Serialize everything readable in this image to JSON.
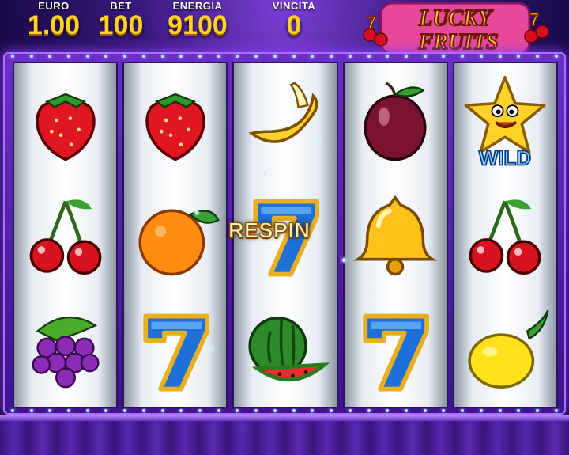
{
  "hud": {
    "stats": [
      {
        "label": "EURO",
        "value": "1.00"
      },
      {
        "label": "BET",
        "value": "100"
      },
      {
        "label": "ENERGIA",
        "value": "9100"
      },
      {
        "label": "VINCITA",
        "value": "0"
      }
    ]
  },
  "logo": {
    "line1": "LUCKY",
    "line2": "FRUITS"
  },
  "reels": [
    [
      "strawberry",
      "cherries",
      "grapes"
    ],
    [
      "strawberry",
      "orange",
      "blue-seven"
    ],
    [
      "banana",
      "blue-seven",
      "watermelon"
    ],
    [
      "plum",
      "golden-bell",
      "blue-seven"
    ],
    [
      "wild-star",
      "cherries",
      "lemon"
    ]
  ],
  "wild_label": "WILD",
  "respin_label": "RESPIN",
  "colors": {
    "value_gold": "#ffd22a",
    "frame_purple": "#6b2fc8"
  }
}
